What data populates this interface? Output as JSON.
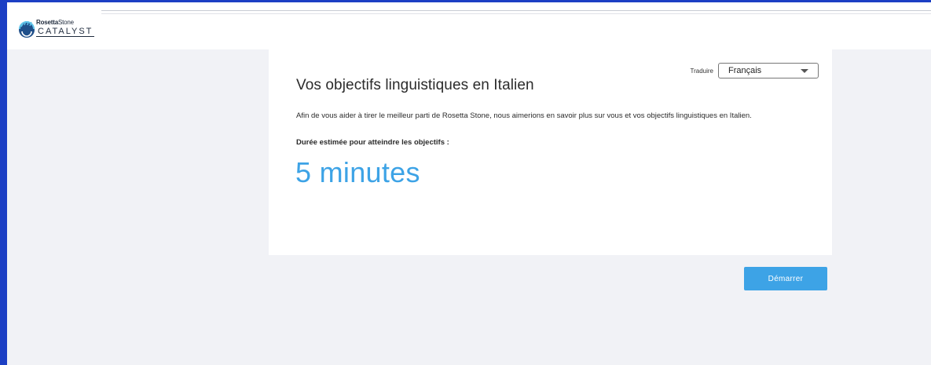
{
  "brand": {
    "name_bold": "Rosetta",
    "name_light": "Stone",
    "product": "CATALYST"
  },
  "translate": {
    "label": "Traduire",
    "selected": "Français"
  },
  "main": {
    "title": "Vos objectifs linguistiques en Italien",
    "intro": "Afin de vous aider à tirer le meilleur parti de Rosetta Stone, nous aimerions en savoir plus sur vous et vos objectifs linguistiques en Italien.",
    "duration_label": "Durée estimée pour atteindre les objectifs :",
    "duration_value": "5 minutes"
  },
  "actions": {
    "start_label": "Démarrer"
  },
  "colors": {
    "accent": "#3da3e6",
    "frame": "#1c3fc4",
    "background": "#f1f2f6"
  }
}
